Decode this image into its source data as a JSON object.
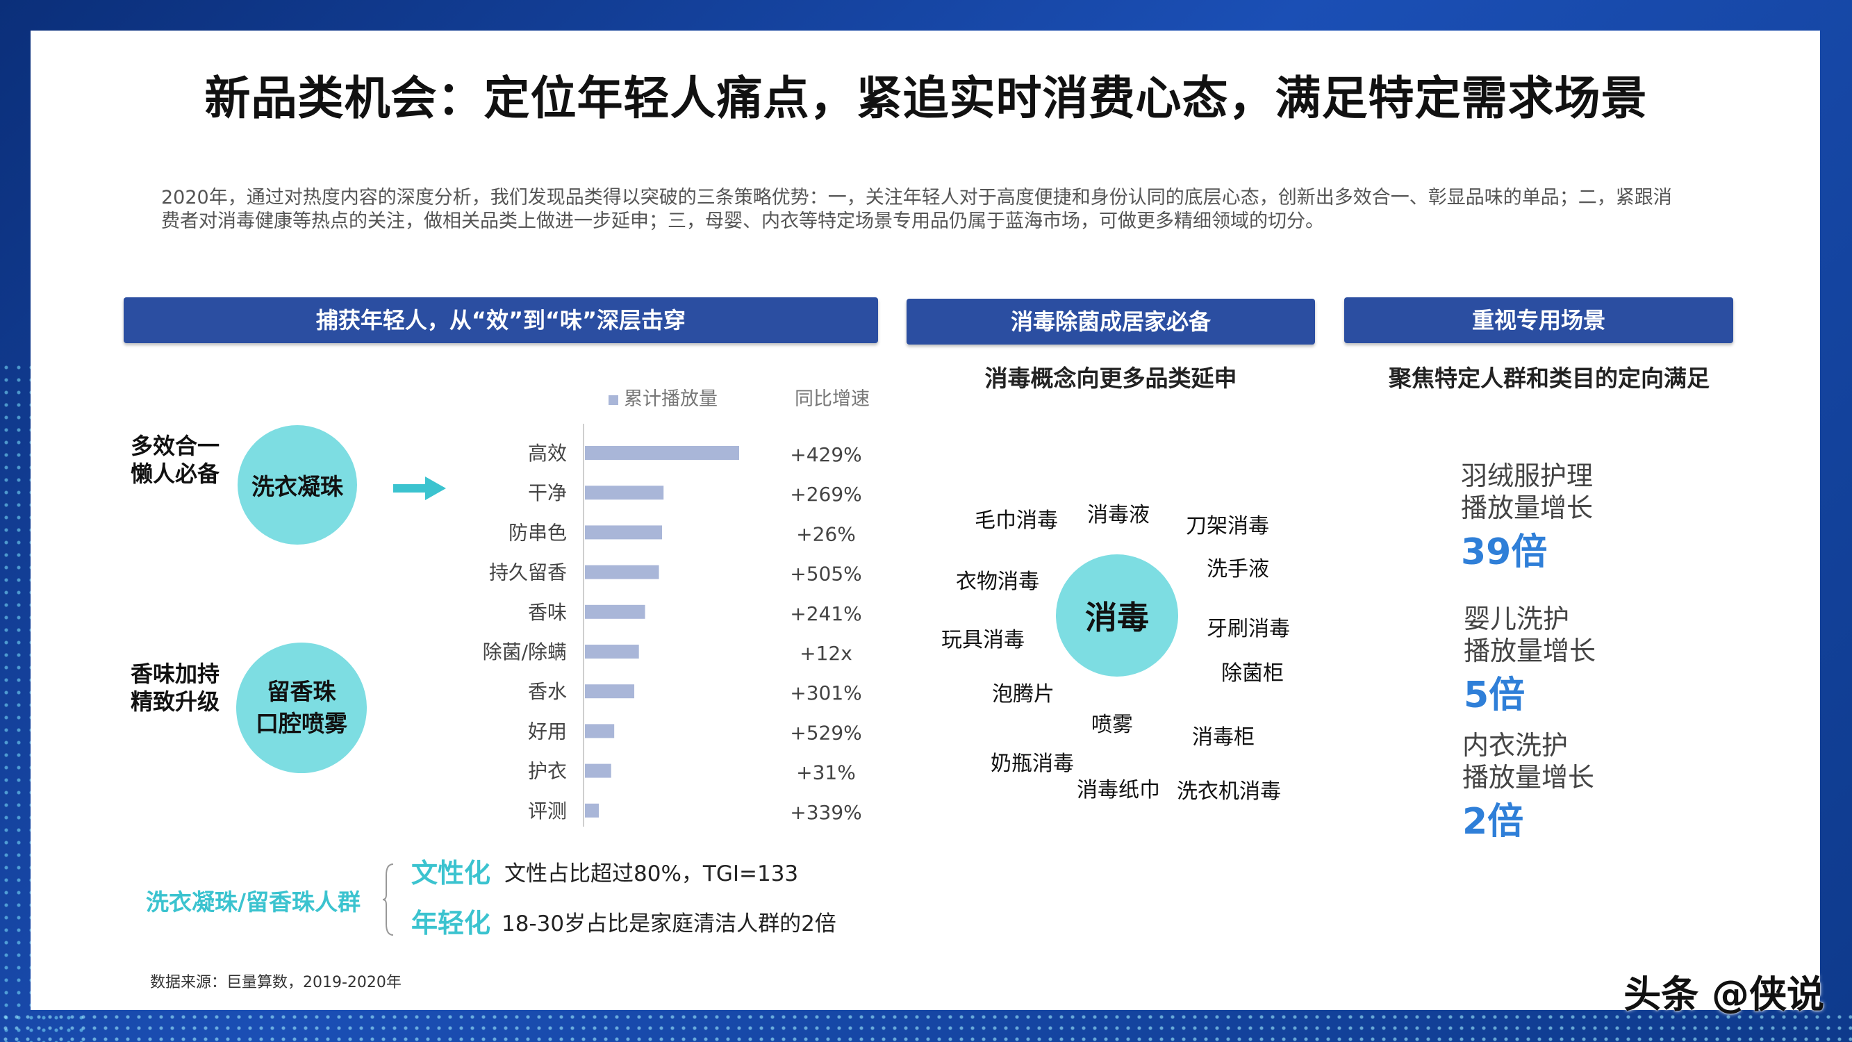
{
  "title": "新品类机会：定位年轻人痛点，紧追实时消费心态，满足特定需求场景",
  "intro": "2020年，通过对热度内容的深度分析，我们发现品类得以突破的三条策略优势：一，关注年轻人对于高度便捷和身份认同的底层心态，创新出多效合一、彰显品味的单品；二，紧跟消费者对消毒健康等热点的关注，做相关品类上做进一步延申；三，母婴、内衣等特定场景专用品仍属于蓝海市场，可做更多精细领域的切分。",
  "sections": {
    "left": {
      "header": "捕获年轻人，从“效”到“味”深层击穿",
      "group1": {
        "label": "多效合一\n懒人必备",
        "circle": "洗衣凝珠"
      },
      "group2": {
        "label": "香味加持\n精致升级",
        "circle": "留香珠\n口腔喷雾"
      },
      "legend_label": "累计播放量",
      "growth_header": "同比增速"
    },
    "middle": {
      "header": "消毒除菌成居家必备",
      "subhead": "消毒概念向更多品类延申",
      "center_word": "消毒",
      "words": [
        "毛巾消毒",
        "消毒液",
        "刀架消毒",
        "洗手液",
        "衣物消毒",
        "牙刷消毒",
        "玩具消毒",
        "除菌柜",
        "泡腾片",
        "喷雾",
        "消毒柜",
        "奶瓶消毒",
        "消毒纸巾",
        "洗衣机消毒"
      ]
    },
    "right": {
      "header": "重视专用场景",
      "subhead": "聚焦特定人群和类目的定向满足",
      "stats": [
        {
          "name": "羽绒服护理",
          "metric": "播放量增长",
          "value": "39倍"
        },
        {
          "name": "婴儿洗护",
          "metric": "播放量增长",
          "value": "5倍"
        },
        {
          "name": "内衣洗护",
          "metric": "播放量增长",
          "value": "2倍"
        }
      ]
    }
  },
  "persona": {
    "label": "洗衣凝珠/留香珠人群",
    "tags": [
      {
        "tag": "文性化",
        "desc": "文性占比超过80%，TGI=133"
      },
      {
        "tag": "年轻化",
        "desc": "18-30岁占比是家庭清洁人群的2倍"
      }
    ]
  },
  "source": "数据来源：巨量算数，2019-2020年",
  "watermark": "头条 @侠说",
  "colors": {
    "bar": "#a9b6d8",
    "header": "#2b4ea1",
    "circle": "#7ddde2",
    "accent": "#3bc3cf",
    "stat": "#2f7fd8"
  },
  "chart_data": {
    "type": "bar",
    "orientation": "horizontal",
    "categories": [
      "高效",
      "干净",
      "防串色",
      "持久留香",
      "香味",
      "除菌/除螨",
      "香水",
      "好用",
      "护衣",
      "评测"
    ],
    "series": [
      {
        "name": "累计播放量",
        "values": [
          100,
          51,
          50,
          48,
          39,
          35,
          32,
          19,
          17,
          9
        ]
      }
    ],
    "growth_labels": [
      "+429%",
      "+269%",
      "+26%",
      "+505%",
      "+241%",
      "+12x",
      "+301%",
      "+529%",
      "+31%",
      "+339%"
    ],
    "xlim": [
      0,
      100
    ],
    "grid": false,
    "legend": "top"
  }
}
